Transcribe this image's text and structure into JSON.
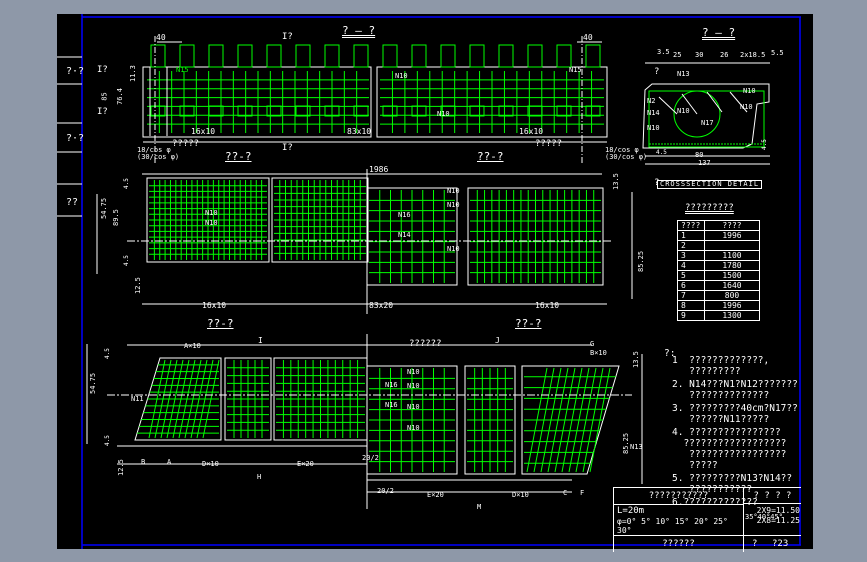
{
  "frame": {
    "side_labels": [
      "?·?",
      "?·?",
      "??"
    ],
    "border_color": "#0000ff",
    "rebar_color": "#00ff00"
  },
  "elevation": {
    "title": "? — ?",
    "cut_top": "I?",
    "cut_bottom": "I?",
    "dims": [
      "40",
      "40",
      "16x10",
      "83x10",
      "16x10",
      "3",
      "5",
      "5",
      "3",
      "85",
      "76.4",
      "11.3",
      "25",
      "15"
    ],
    "rebar_labels": [
      "N15",
      "N15",
      "N13",
      "N13",
      "N13",
      "N13",
      "N10",
      "N15",
      "N13",
      "N11",
      "N13",
      "N11",
      "N12",
      "N12",
      "N10"
    ],
    "note_left": "?????",
    "note_right": "?????",
    "spacing_left": "18/cos φ\n(30/cos φ)",
    "spacing_right": "18/cos φ\n(30/cos φ)",
    "side_marks": [
      "I?",
      "I?"
    ]
  },
  "section": {
    "title": "? — ?",
    "dims_top": [
      "3.5",
      "25",
      "30",
      "26",
      "2x18.5",
      "5.5"
    ],
    "dims_bottom": [
      "5",
      "4.5",
      "80",
      "5",
      "5",
      "37",
      "3"
    ],
    "total": "137",
    "right_dims": [
      "3x16",
      "4.5"
    ],
    "labels": [
      "N13",
      "N2",
      "N14",
      "N10",
      "N10",
      "N17",
      "N10",
      "N10",
      "N10"
    ],
    "marks": [
      "?",
      "?"
    ],
    "hatch_caption": "CROSSSECTION DETAIL"
  },
  "plan_right": {
    "title1": "??-?",
    "title2": "??-?",
    "total": "1986",
    "dims_bottom": [
      "3",
      "5",
      "16x10",
      "83x20",
      "16x10",
      "5",
      "3"
    ],
    "dims_left": [
      "54.75",
      "89.5",
      "80",
      "4.5",
      "4.5",
      "17",
      "5",
      "12.5"
    ],
    "dims_right": [
      "13.5",
      "25",
      "30",
      "25",
      "2x18.5",
      "5.5",
      "127",
      "85.25"
    ],
    "labels": [
      "N10",
      "N10",
      "N11",
      "N11",
      "N10",
      "N16",
      "N10",
      "N14",
      "N10",
      "N12",
      "N13"
    ]
  },
  "plan_skew": {
    "title1": "??-?",
    "title2": "??-?",
    "dims": [
      "I",
      "J",
      "A×10",
      "G",
      "B×10",
      "B",
      "A",
      "D×10",
      "E×20",
      "20/2",
      "H",
      "20/2",
      "E×20",
      "D×10",
      "C",
      "F",
      "M"
    ],
    "note": "??????",
    "labels": [
      "N11",
      "N16",
      "N16",
      "N10",
      "N10",
      "N10",
      "N10",
      "N13",
      "φ"
    ],
    "dims_left": [
      "54.75",
      "89",
      "80",
      "4.5",
      "4.5",
      "12",
      "5",
      "12.5"
    ],
    "dims_right": [
      "13.5",
      "25",
      "30",
      "26",
      "2x18.5",
      "3.5",
      "127",
      "85.25"
    ]
  },
  "rebar_table": {
    "title": "?????????",
    "headers": [
      "????",
      "????"
    ],
    "rows": [
      [
        "1",
        "1996"
      ],
      [
        "2",
        ""
      ],
      [
        "3",
        "1100"
      ],
      [
        "4",
        "1780"
      ],
      [
        "5",
        "1500"
      ],
      [
        "6",
        "1640"
      ],
      [
        "7",
        "800"
      ],
      [
        "8",
        "1996"
      ],
      [
        "9",
        "1300"
      ]
    ]
  },
  "notes": {
    "heading": "?:",
    "items": [
      "1  ?????????????,\n   ?????????",
      "2. N14???N1?N12???????\n   ??????????????",
      "3. ?????????40cm?N17??\n   ??????N11?????",
      "4. ????????????????\n  ??????????????????\n   ?????????????????\n   ?????",
      "5. ?????????N13?N14??\n   ???????????",
      "6.?????????????"
    ]
  },
  "title_block": {
    "heading": "???????????",
    "scale": "? ? ? ?",
    "span": "L=20m",
    "angles": "φ=0° 5° 10° 15° 20° 25° 30°",
    "angles_extra": "35°40°45°",
    "values": [
      "2X9=11.50",
      "2X8=11.25"
    ],
    "drawing_name": "??????",
    "sheet_label": "?",
    "sheet_number": "?23"
  }
}
